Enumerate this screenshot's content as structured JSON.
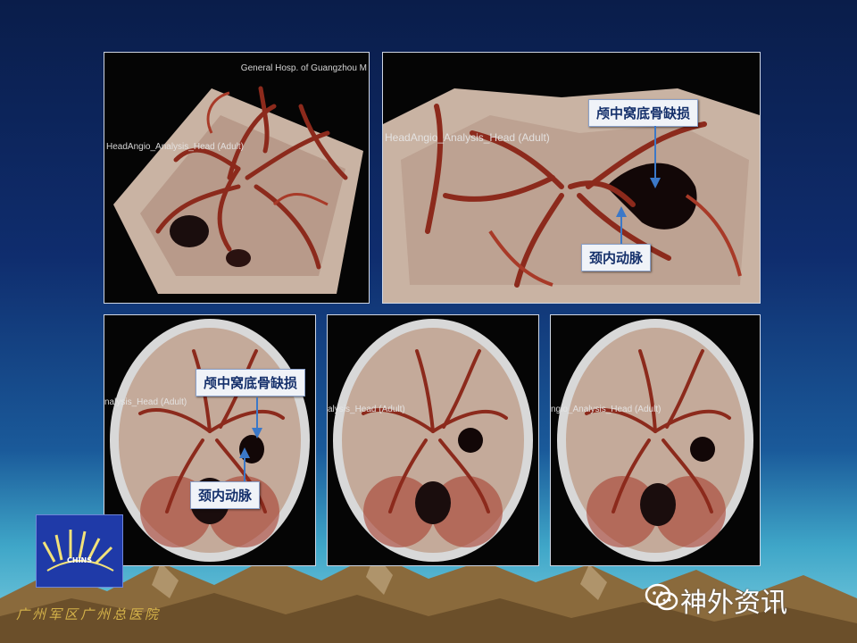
{
  "panels": {
    "top_left": {
      "watermarks": [
        "General Hosp. of Guangzhou M",
        "HeadAngio_Analysis_Head (Adult)"
      ]
    },
    "top_right": {
      "watermark": "HeadAngio_Analysis_Head (Adult)",
      "callouts": {
        "defect": "颅中窝底骨缺损",
        "artery": "颈内动脉"
      }
    },
    "bottom_left": {
      "watermark": "nalysis_Head (Adult)",
      "callouts": {
        "defect": "颅中窝底骨缺损",
        "artery": "颈内动脉"
      }
    },
    "bottom_middle": {
      "watermark": "alysis_Head (Adult)"
    },
    "bottom_right": {
      "watermark": "ngio_Analysis_Head (Adult)"
    }
  },
  "logo": {
    "text": "CHINS"
  },
  "footer": {
    "hospital": "广州军区广州总医院",
    "brand": "神外资讯"
  },
  "colors": {
    "callout_text": "#15306b",
    "arrow": "#3b78c8",
    "hospital_text": "#d4b24a"
  }
}
